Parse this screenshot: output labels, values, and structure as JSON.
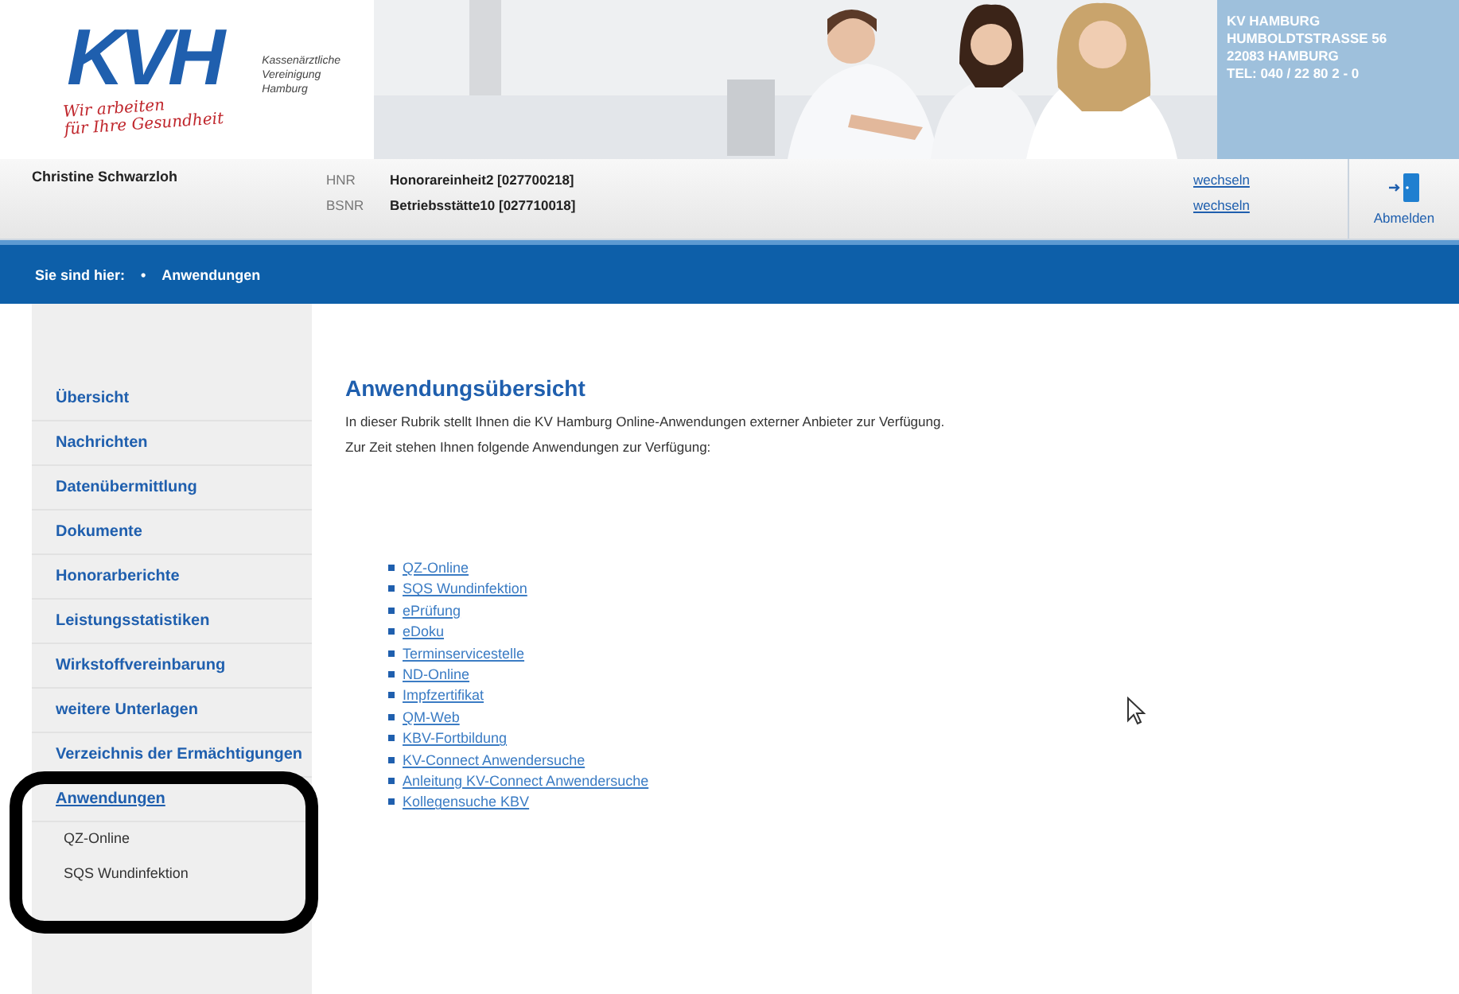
{
  "header": {
    "logo": {
      "mark": "KVH",
      "org_lines": [
        "Kassenärztliche",
        "Vereinigung",
        "Hamburg"
      ],
      "slogan_lines": [
        "Wir arbeiten",
        "für Ihre Gesundheit"
      ]
    },
    "address_lines": [
      "KV HAMBURG",
      "HUMBOLDTSTRASSE 56",
      "22083 HAMBURG",
      "TEL: 040 / 22 80 2 - 0"
    ]
  },
  "user_bar": {
    "user_name": "Christine Schwarzloh",
    "rows": [
      {
        "label": "HNR",
        "value": "Honorareinheit2 [027700218]",
        "link": "wechseln"
      },
      {
        "label": "BSNR",
        "value": "Betriebsstätte10 [027710018]",
        "link": "wechseln"
      }
    ],
    "logout": "Abmelden"
  },
  "breadcrumb": {
    "label": "Sie sind hier:",
    "marker": "•",
    "items": [
      "Anwendungen"
    ]
  },
  "sidebar": {
    "items": [
      {
        "label": "Übersicht",
        "selected": false,
        "highlighted": false
      },
      {
        "label": "Nachrichten",
        "selected": false,
        "highlighted": false
      },
      {
        "label": "Datenübermittlung",
        "selected": false,
        "highlighted": false
      },
      {
        "label": "Dokumente",
        "selected": false,
        "highlighted": false
      },
      {
        "label": "Honorarberichte",
        "selected": false,
        "highlighted": false
      },
      {
        "label": "Leistungsstatistiken",
        "selected": false,
        "highlighted": false
      },
      {
        "label": "Wirkstoffvereinbarung",
        "selected": false,
        "highlighted": false
      },
      {
        "label": "weitere Unterlagen",
        "selected": false,
        "highlighted": false
      },
      {
        "label": "Verzeichnis der Ermächtigungen",
        "selected": false,
        "highlighted": false
      },
      {
        "label": "Anwendungen",
        "selected": true,
        "highlighted": true,
        "children": [
          {
            "label": "QZ-Online"
          },
          {
            "label": "SQS Wundinfektion"
          }
        ]
      }
    ]
  },
  "content": {
    "title": "Anwendungsübersicht",
    "paragraphs": [
      "In dieser Rubrik stellt Ihnen die KV Hamburg Online-Anwendungen externer Anbieter zur Verfügung.",
      "Zur Zeit stehen Ihnen folgende Anwendungen zur Verfügung:"
    ],
    "links": [
      "QZ-Online",
      "SQS Wundinfektion",
      "ePrüfung",
      "eDoku",
      "Terminservicestelle",
      "ND-Online",
      "Impfzertifikat",
      "QM-Web",
      "KBV-Fortbildung",
      "KV-Connect Anwendersuche",
      "Anleitung KV-Connect Anwendersuche",
      "Kollegensuche KBV"
    ]
  }
}
